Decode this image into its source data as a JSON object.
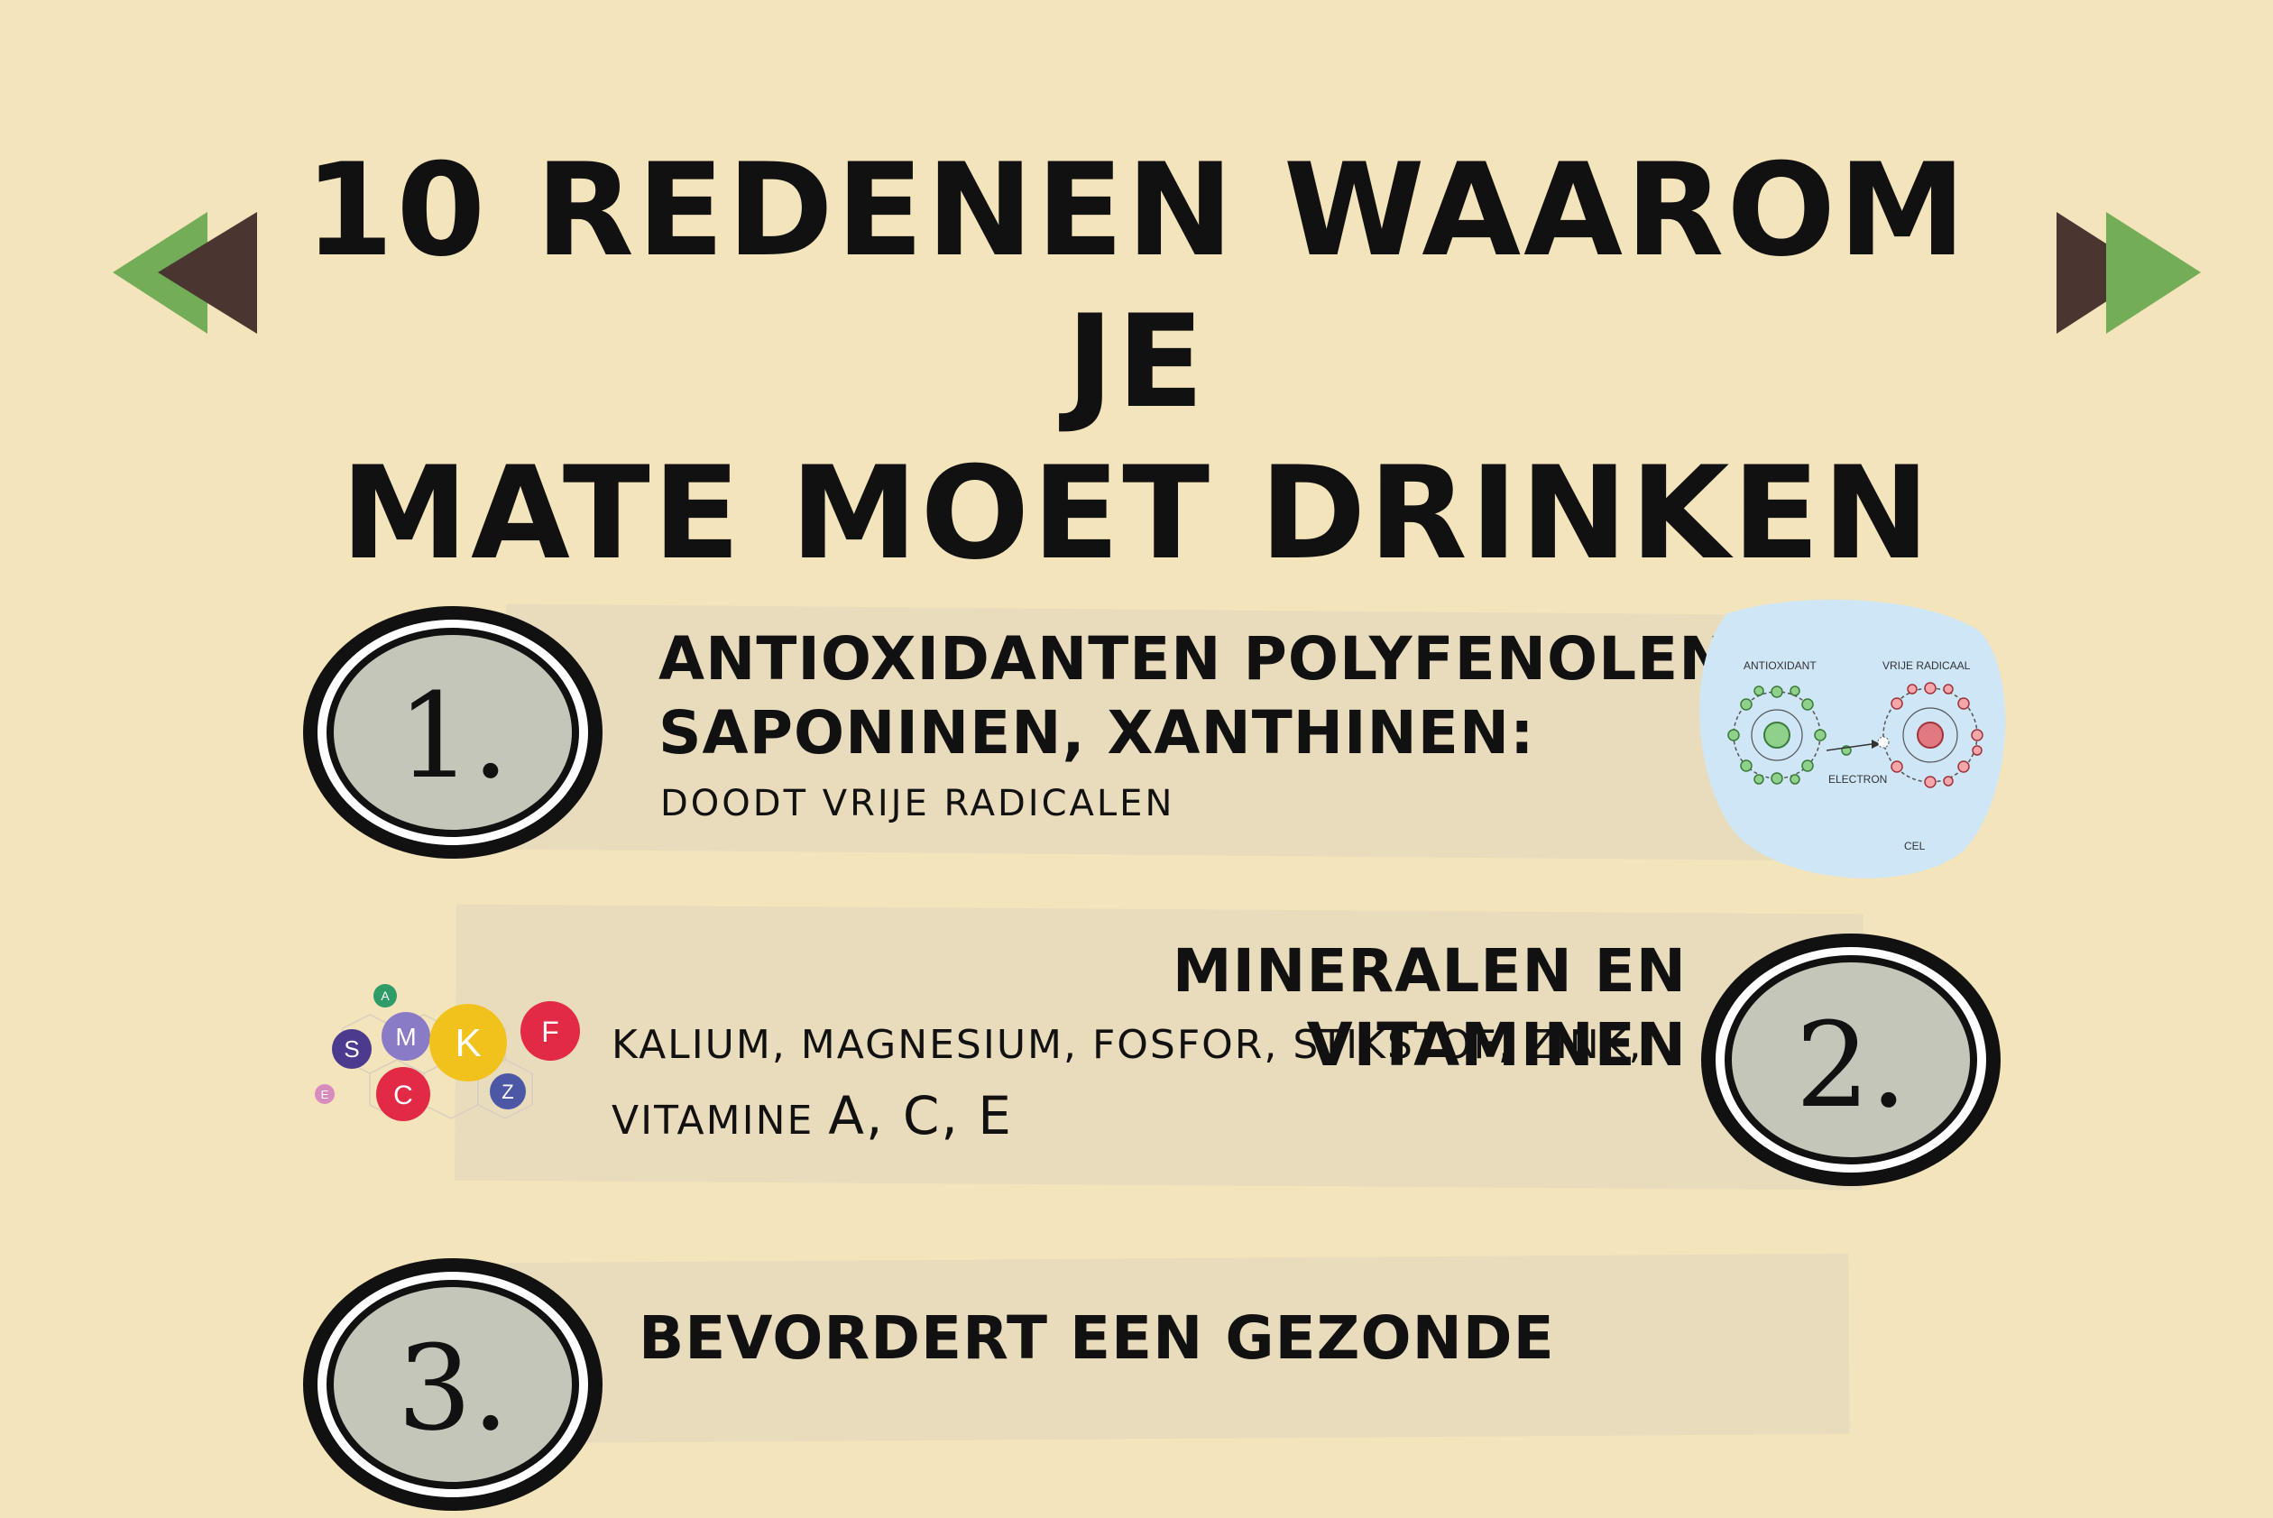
{
  "title": {
    "line1": "10 REDENEN WAAROM JE",
    "line2": "MATE MOET DRINKEN"
  },
  "nav": {
    "prev_icon": "triangle-left-icon",
    "next_icon": "triangle-right-icon"
  },
  "colors": {
    "background": "#f3e4bb",
    "band": "#e9dcbd",
    "arrow_dark": "#4a3530",
    "arrow_green": "#73ad57",
    "badge_fill": "#c3c6b9",
    "diagram_bg": "#cfe6f6"
  },
  "items": [
    {
      "number": "1.",
      "heading_line1": "ANTIOXIDANTEN POLYFENOLEN,",
      "heading_line2": "SAPONINEN, XANTHINEN:",
      "subtitle": "DOODT VRIJE RADICALEN",
      "diagram": {
        "label_left": "ANTIOXIDANT",
        "label_right": "VRIJE RADICAAL",
        "label_middle": "ELECTRON",
        "label_bottom": "CEL"
      }
    },
    {
      "number": "2.",
      "heading": "MINERALEN EN VITAMINEN",
      "line1": "KALIUM, MAGNESIUM, FOSFOR, STIKSTOF, ZINK,",
      "line2_prefix": "VITAMINE ",
      "line2_letters": "A, C, E",
      "molecules": [
        "A",
        "S",
        "M",
        "K",
        "F",
        "E",
        "C",
        "Z"
      ]
    },
    {
      "number": "3.",
      "heading": "BEVORDERT EEN GEZONDE"
    }
  ]
}
